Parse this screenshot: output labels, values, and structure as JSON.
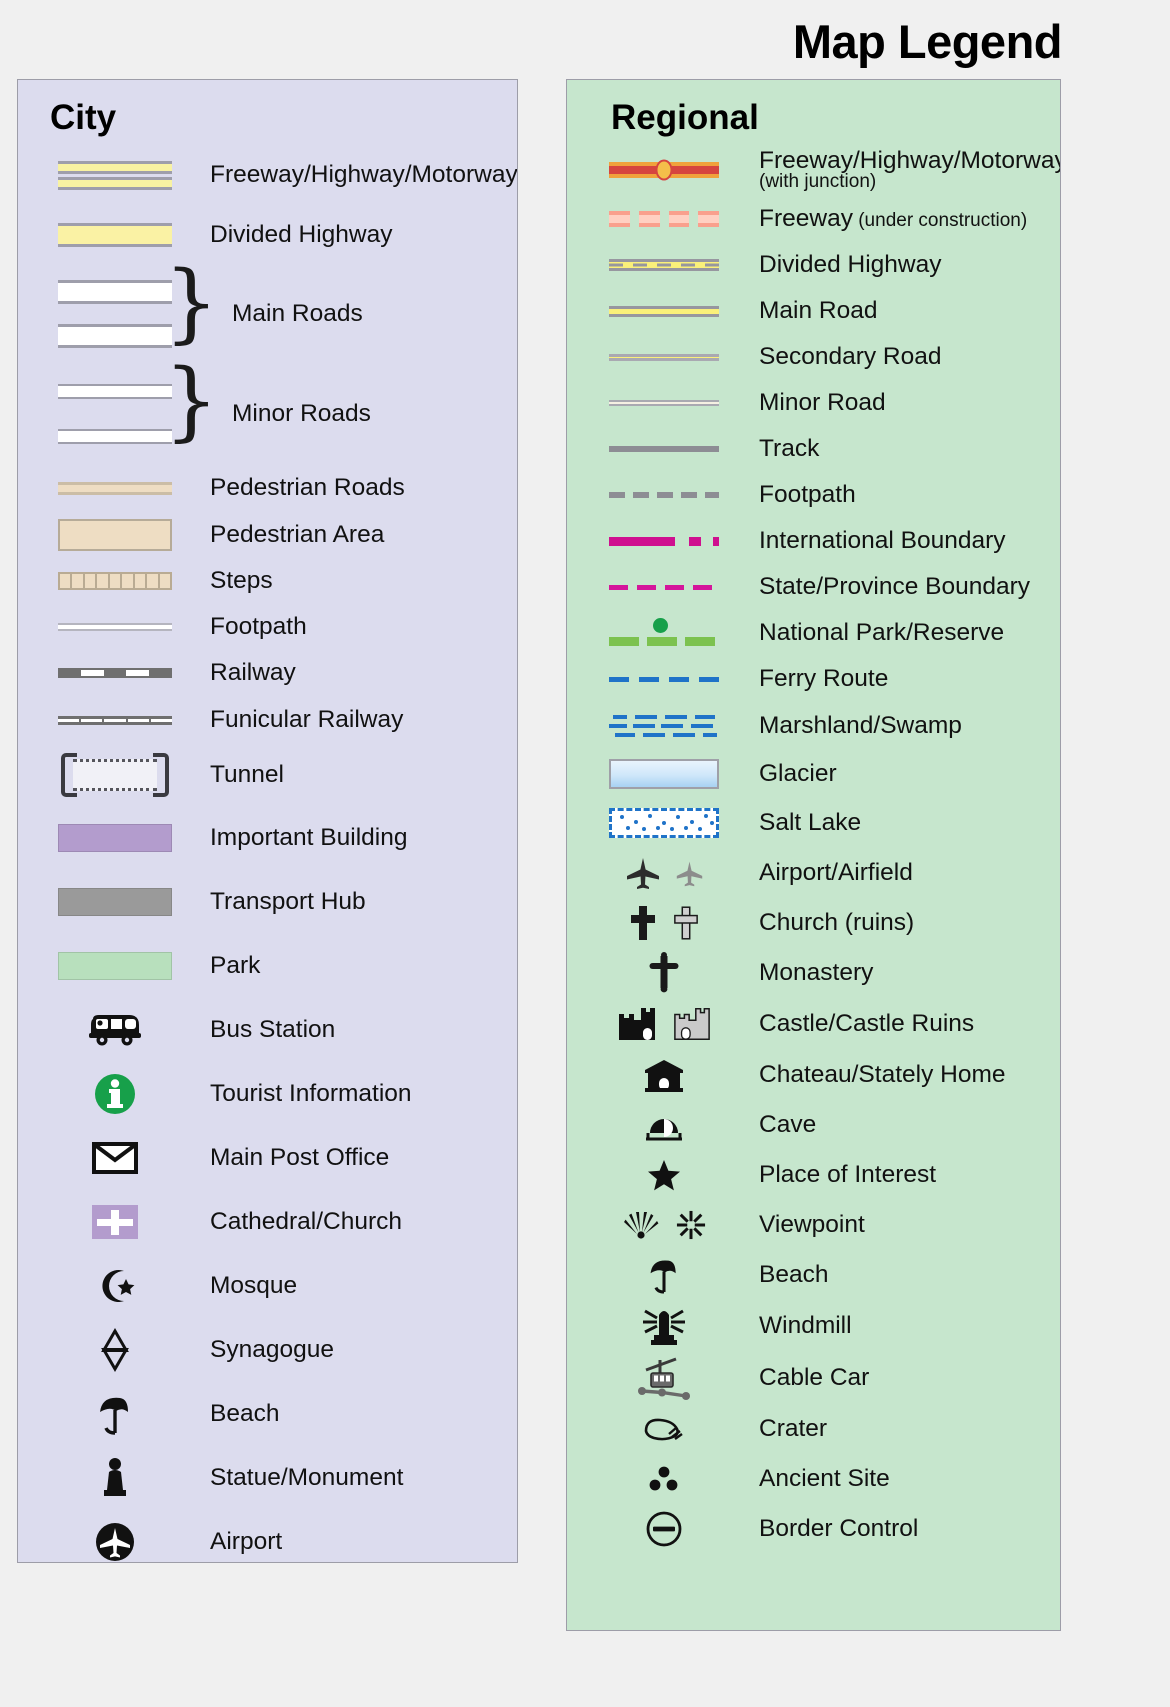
{
  "header": {
    "title": "Map Legend"
  },
  "colors": {
    "page_background": "#f0f0f0",
    "city_panel": "#dcdcee",
    "regional_panel": "#c6e6cd",
    "panel_border": "#9d9da8",
    "freeway_fill": "#f8f2a2",
    "freeway_casing": "#9e9eab",
    "pedestrian": "#eeddc3",
    "important_building": "#b39ccd",
    "transport_hub": "#9a9a9a",
    "park": "#b8e0bd",
    "regional_freeway_red": "#d6453f",
    "regional_freeway_orange": "#f0a23c",
    "freeway_under_construction": "#f9a08d",
    "divided_highway_yellow": "#faf07a",
    "international_boundary": "#cf0f8f",
    "state_boundary": "#d4169b",
    "national_park_green": "#7cc24f",
    "ferry_blue": "#1f73c8",
    "glacier_blue": "#cfe7fa",
    "tourist_info_green": "#17a04a"
  },
  "city": {
    "title": "City",
    "items": [
      {
        "icon": "freeway-highway-motorway-swatch",
        "label": "Freeway/Highway/Motorway"
      },
      {
        "icon": "divided-highway-swatch",
        "label": "Divided Highway"
      },
      {
        "icon": "main-roads-swatch",
        "label": "Main Roads",
        "braced": true
      },
      {
        "icon": "minor-roads-swatch",
        "label": "Minor Roads",
        "braced": true
      },
      {
        "icon": "pedestrian-roads-swatch",
        "label": "Pedestrian Roads"
      },
      {
        "icon": "pedestrian-area-swatch",
        "label": "Pedestrian Area"
      },
      {
        "icon": "steps-swatch",
        "label": "Steps"
      },
      {
        "icon": "footpath-swatch",
        "label": "Footpath"
      },
      {
        "icon": "railway-swatch",
        "label": "Railway"
      },
      {
        "icon": "funicular-railway-swatch",
        "label": "Funicular Railway"
      },
      {
        "icon": "tunnel-swatch",
        "label": "Tunnel"
      },
      {
        "icon": "important-building-swatch",
        "label": "Important Building"
      },
      {
        "icon": "transport-hub-swatch",
        "label": "Transport Hub"
      },
      {
        "icon": "park-swatch",
        "label": "Park"
      },
      {
        "icon": "bus-station-icon",
        "label": "Bus Station"
      },
      {
        "icon": "tourist-information-icon",
        "label": "Tourist Information"
      },
      {
        "icon": "main-post-office-icon",
        "label": "Main Post Office"
      },
      {
        "icon": "cathedral-church-icon",
        "label": "Cathedral/Church"
      },
      {
        "icon": "mosque-icon",
        "label": "Mosque"
      },
      {
        "icon": "synagogue-icon",
        "label": "Synagogue"
      },
      {
        "icon": "beach-icon",
        "label": "Beach"
      },
      {
        "icon": "statue-monument-icon",
        "label": "Statue/Monument"
      },
      {
        "icon": "airport-icon",
        "label": "Airport"
      }
    ]
  },
  "regional": {
    "title": "Regional",
    "items": [
      {
        "icon": "freeway-with-junction-swatch",
        "label": "Freeway/Highway/Motorway",
        "sub_line": "(with junction)"
      },
      {
        "icon": "freeway-under-construction-swatch",
        "label": "Freeway",
        "sub_inline": " (under construction)"
      },
      {
        "icon": "divided-highway-swatch",
        "label": "Divided Highway"
      },
      {
        "icon": "main-road-swatch",
        "label": "Main Road"
      },
      {
        "icon": "secondary-road-swatch",
        "label": "Secondary Road"
      },
      {
        "icon": "minor-road-swatch",
        "label": "Minor Road"
      },
      {
        "icon": "track-swatch",
        "label": "Track"
      },
      {
        "icon": "footpath-swatch",
        "label": "Footpath"
      },
      {
        "icon": "international-boundary-swatch",
        "label": "International Boundary"
      },
      {
        "icon": "state-province-boundary-swatch",
        "label": "State/Province Boundary"
      },
      {
        "icon": "national-park-reserve-swatch",
        "label": "National Park/Reserve"
      },
      {
        "icon": "ferry-route-swatch",
        "label": "Ferry Route"
      },
      {
        "icon": "marshland-swamp-swatch",
        "label": "Marshland/Swamp"
      },
      {
        "icon": "glacier-swatch",
        "label": "Glacier"
      },
      {
        "icon": "salt-lake-swatch",
        "label": "Salt Lake"
      },
      {
        "icon": "airport-airfield-icon",
        "label": "Airport/Airfield"
      },
      {
        "icon": "church-ruins-icon",
        "label": "Church (ruins)"
      },
      {
        "icon": "monastery-icon",
        "label": "Monastery"
      },
      {
        "icon": "castle-castle-ruins-icon",
        "label": "Castle/Castle Ruins"
      },
      {
        "icon": "chateau-stately-home-icon",
        "label": "Chateau/Stately Home"
      },
      {
        "icon": "cave-icon",
        "label": "Cave"
      },
      {
        "icon": "place-of-interest-icon",
        "label": "Place of Interest"
      },
      {
        "icon": "viewpoint-icon",
        "label": "Viewpoint"
      },
      {
        "icon": "beach-icon",
        "label": "Beach"
      },
      {
        "icon": "windmill-icon",
        "label": "Windmill"
      },
      {
        "icon": "cable-car-icon",
        "label": "Cable Car"
      },
      {
        "icon": "crater-icon",
        "label": "Crater"
      },
      {
        "icon": "ancient-site-icon",
        "label": "Ancient Site"
      },
      {
        "icon": "border-control-icon",
        "label": "Border Control"
      }
    ]
  }
}
